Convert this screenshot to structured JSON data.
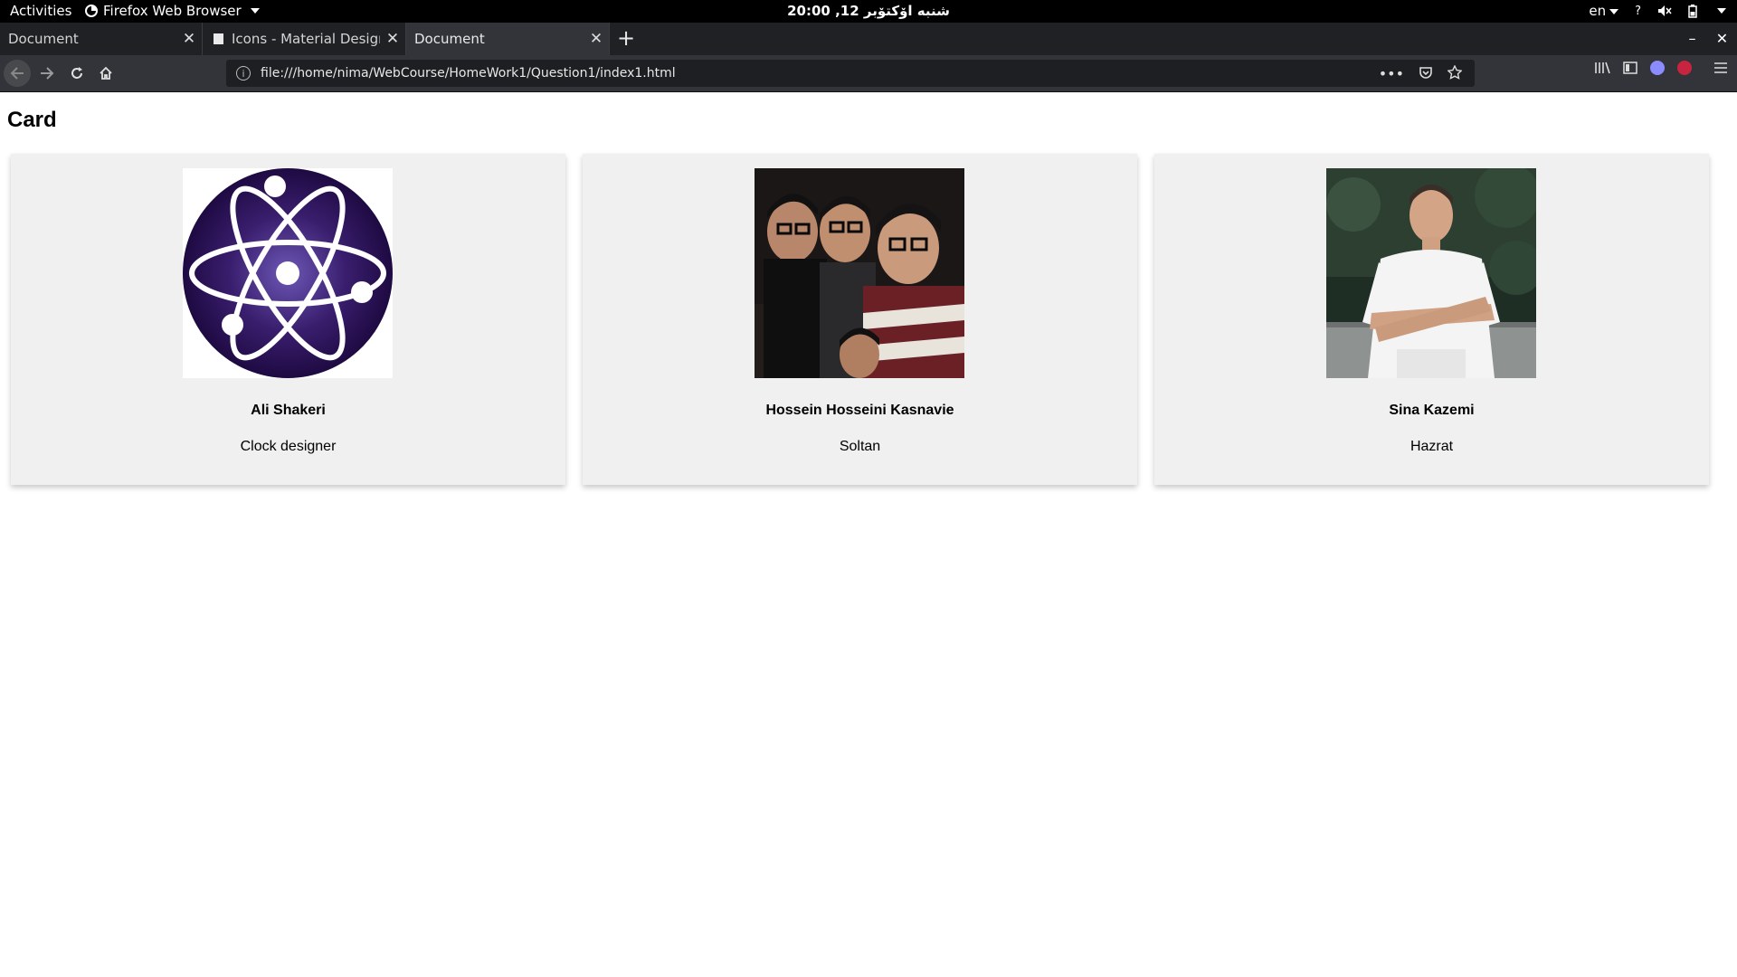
{
  "topbar": {
    "activities": "Activities",
    "app_name": "Firefox Web Browser",
    "clock": "شنبه اۆکتۆبر 12, 20:00",
    "lang": "en",
    "help": "?"
  },
  "tabs": [
    {
      "title": "Document",
      "active": false
    },
    {
      "title": "Icons - Material Design",
      "active": false
    },
    {
      "title": "Document",
      "active": true
    }
  ],
  "toolbar": {
    "url": "file:///home/nima/WebCourse/HomeWork1/Question1/index1.html",
    "more_label": "•••"
  },
  "page": {
    "heading": "Card",
    "cards": [
      {
        "name": "Ali Shakeri",
        "role": "Clock designer",
        "image": "atom-logo"
      },
      {
        "name": "Hossein Hosseini Kasnavie",
        "role": "Soltan",
        "image": "group-selfie-photo"
      },
      {
        "name": "Sina Kazemi",
        "role": "Hazrat",
        "image": "portrait-photo"
      }
    ]
  },
  "colors": {
    "card_bg": "#f0f0f0",
    "atom_bg": "#2a1250",
    "chrome_dark": "#1f2124",
    "toolbar": "#323439"
  }
}
